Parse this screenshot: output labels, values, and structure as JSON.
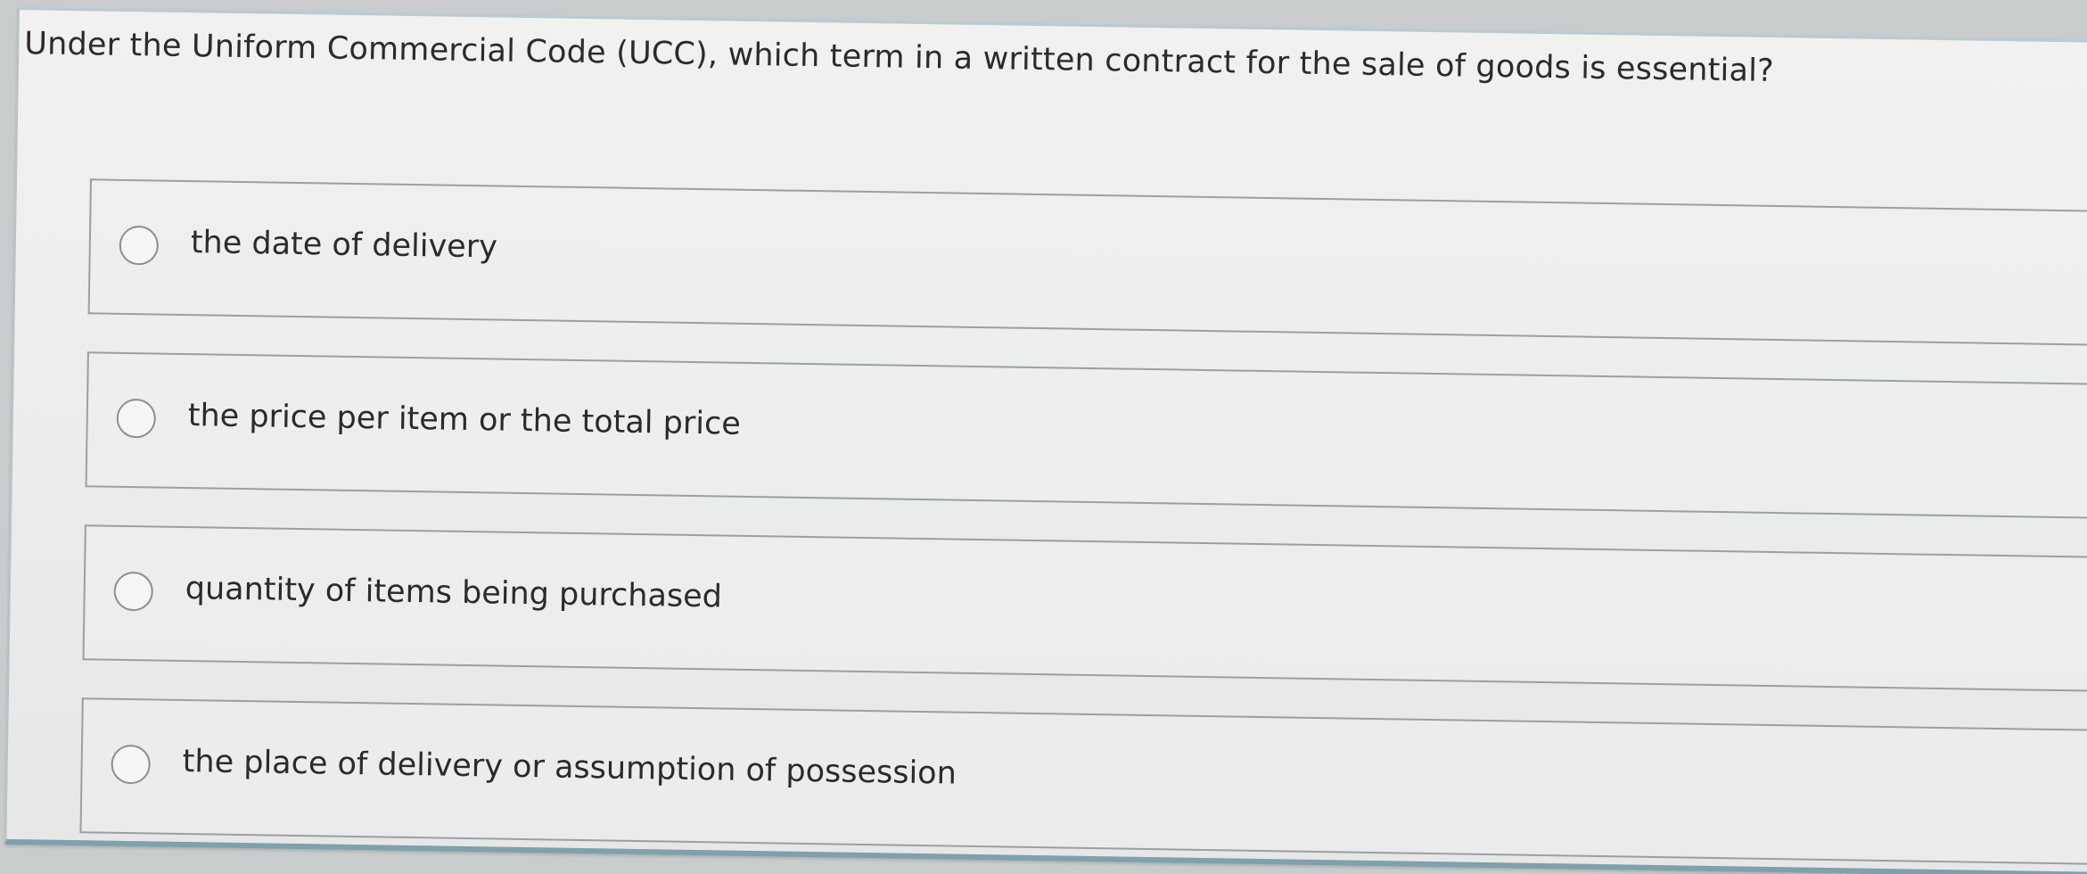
{
  "question": {
    "text": "Under the Uniform Commercial Code (UCC), which term in a written contract for the sale of goods is essential?"
  },
  "options": [
    {
      "label": "the date of delivery",
      "selected": false
    },
    {
      "label": "the price per item or the total price",
      "selected": false
    },
    {
      "label": "quantity of items being purchased",
      "selected": false
    },
    {
      "label": "the place of delivery or assumption of possession",
      "selected": false
    }
  ],
  "colors": {
    "panel_border_accent": "#7fa0ad",
    "text": "#2b2b2b",
    "option_border": "#9aa0a2"
  }
}
